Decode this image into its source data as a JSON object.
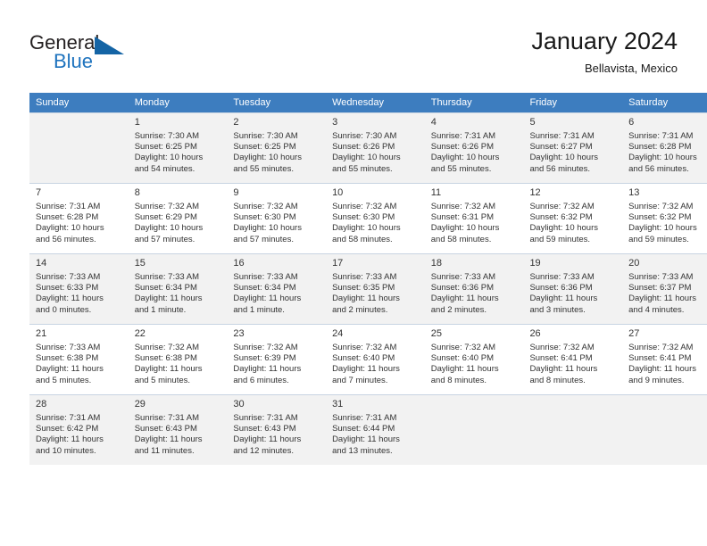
{
  "brand": {
    "name_top": "General",
    "name_bottom": "Blue",
    "triangle_color": "#1464a5",
    "blue_color": "#1e73be"
  },
  "header": {
    "title": "January 2024",
    "subtitle": "Bellavista, Mexico"
  },
  "theme": {
    "header_row_bg": "#3d7dbf",
    "alt_row_bg": "#f2f2f2",
    "text": "#333333"
  },
  "weekdays": [
    "Sunday",
    "Monday",
    "Tuesday",
    "Wednesday",
    "Thursday",
    "Friday",
    "Saturday"
  ],
  "weeks": [
    [
      {
        "day": "",
        "lines": []
      },
      {
        "day": "1",
        "lines": [
          "Sunrise: 7:30 AM",
          "Sunset: 6:25 PM",
          "Daylight: 10 hours",
          "and 54 minutes."
        ]
      },
      {
        "day": "2",
        "lines": [
          "Sunrise: 7:30 AM",
          "Sunset: 6:25 PM",
          "Daylight: 10 hours",
          "and 55 minutes."
        ]
      },
      {
        "day": "3",
        "lines": [
          "Sunrise: 7:30 AM",
          "Sunset: 6:26 PM",
          "Daylight: 10 hours",
          "and 55 minutes."
        ]
      },
      {
        "day": "4",
        "lines": [
          "Sunrise: 7:31 AM",
          "Sunset: 6:26 PM",
          "Daylight: 10 hours",
          "and 55 minutes."
        ]
      },
      {
        "day": "5",
        "lines": [
          "Sunrise: 7:31 AM",
          "Sunset: 6:27 PM",
          "Daylight: 10 hours",
          "and 56 minutes."
        ]
      },
      {
        "day": "6",
        "lines": [
          "Sunrise: 7:31 AM",
          "Sunset: 6:28 PM",
          "Daylight: 10 hours",
          "and 56 minutes."
        ]
      }
    ],
    [
      {
        "day": "7",
        "lines": [
          "Sunrise: 7:31 AM",
          "Sunset: 6:28 PM",
          "Daylight: 10 hours",
          "and 56 minutes."
        ]
      },
      {
        "day": "8",
        "lines": [
          "Sunrise: 7:32 AM",
          "Sunset: 6:29 PM",
          "Daylight: 10 hours",
          "and 57 minutes."
        ]
      },
      {
        "day": "9",
        "lines": [
          "Sunrise: 7:32 AM",
          "Sunset: 6:30 PM",
          "Daylight: 10 hours",
          "and 57 minutes."
        ]
      },
      {
        "day": "10",
        "lines": [
          "Sunrise: 7:32 AM",
          "Sunset: 6:30 PM",
          "Daylight: 10 hours",
          "and 58 minutes."
        ]
      },
      {
        "day": "11",
        "lines": [
          "Sunrise: 7:32 AM",
          "Sunset: 6:31 PM",
          "Daylight: 10 hours",
          "and 58 minutes."
        ]
      },
      {
        "day": "12",
        "lines": [
          "Sunrise: 7:32 AM",
          "Sunset: 6:32 PM",
          "Daylight: 10 hours",
          "and 59 minutes."
        ]
      },
      {
        "day": "13",
        "lines": [
          "Sunrise: 7:32 AM",
          "Sunset: 6:32 PM",
          "Daylight: 10 hours",
          "and 59 minutes."
        ]
      }
    ],
    [
      {
        "day": "14",
        "lines": [
          "Sunrise: 7:33 AM",
          "Sunset: 6:33 PM",
          "Daylight: 11 hours",
          "and 0 minutes."
        ]
      },
      {
        "day": "15",
        "lines": [
          "Sunrise: 7:33 AM",
          "Sunset: 6:34 PM",
          "Daylight: 11 hours",
          "and 1 minute."
        ]
      },
      {
        "day": "16",
        "lines": [
          "Sunrise: 7:33 AM",
          "Sunset: 6:34 PM",
          "Daylight: 11 hours",
          "and 1 minute."
        ]
      },
      {
        "day": "17",
        "lines": [
          "Sunrise: 7:33 AM",
          "Sunset: 6:35 PM",
          "Daylight: 11 hours",
          "and 2 minutes."
        ]
      },
      {
        "day": "18",
        "lines": [
          "Sunrise: 7:33 AM",
          "Sunset: 6:36 PM",
          "Daylight: 11 hours",
          "and 2 minutes."
        ]
      },
      {
        "day": "19",
        "lines": [
          "Sunrise: 7:33 AM",
          "Sunset: 6:36 PM",
          "Daylight: 11 hours",
          "and 3 minutes."
        ]
      },
      {
        "day": "20",
        "lines": [
          "Sunrise: 7:33 AM",
          "Sunset: 6:37 PM",
          "Daylight: 11 hours",
          "and 4 minutes."
        ]
      }
    ],
    [
      {
        "day": "21",
        "lines": [
          "Sunrise: 7:33 AM",
          "Sunset: 6:38 PM",
          "Daylight: 11 hours",
          "and 5 minutes."
        ]
      },
      {
        "day": "22",
        "lines": [
          "Sunrise: 7:32 AM",
          "Sunset: 6:38 PM",
          "Daylight: 11 hours",
          "and 5 minutes."
        ]
      },
      {
        "day": "23",
        "lines": [
          "Sunrise: 7:32 AM",
          "Sunset: 6:39 PM",
          "Daylight: 11 hours",
          "and 6 minutes."
        ]
      },
      {
        "day": "24",
        "lines": [
          "Sunrise: 7:32 AM",
          "Sunset: 6:40 PM",
          "Daylight: 11 hours",
          "and 7 minutes."
        ]
      },
      {
        "day": "25",
        "lines": [
          "Sunrise: 7:32 AM",
          "Sunset: 6:40 PM",
          "Daylight: 11 hours",
          "and 8 minutes."
        ]
      },
      {
        "day": "26",
        "lines": [
          "Sunrise: 7:32 AM",
          "Sunset: 6:41 PM",
          "Daylight: 11 hours",
          "and 8 minutes."
        ]
      },
      {
        "day": "27",
        "lines": [
          "Sunrise: 7:32 AM",
          "Sunset: 6:41 PM",
          "Daylight: 11 hours",
          "and 9 minutes."
        ]
      }
    ],
    [
      {
        "day": "28",
        "lines": [
          "Sunrise: 7:31 AM",
          "Sunset: 6:42 PM",
          "Daylight: 11 hours",
          "and 10 minutes."
        ]
      },
      {
        "day": "29",
        "lines": [
          "Sunrise: 7:31 AM",
          "Sunset: 6:43 PM",
          "Daylight: 11 hours",
          "and 11 minutes."
        ]
      },
      {
        "day": "30",
        "lines": [
          "Sunrise: 7:31 AM",
          "Sunset: 6:43 PM",
          "Daylight: 11 hours",
          "and 12 minutes."
        ]
      },
      {
        "day": "31",
        "lines": [
          "Sunrise: 7:31 AM",
          "Sunset: 6:44 PM",
          "Daylight: 11 hours",
          "and 13 minutes."
        ]
      },
      {
        "day": "",
        "lines": []
      },
      {
        "day": "",
        "lines": []
      },
      {
        "day": "",
        "lines": []
      }
    ]
  ]
}
